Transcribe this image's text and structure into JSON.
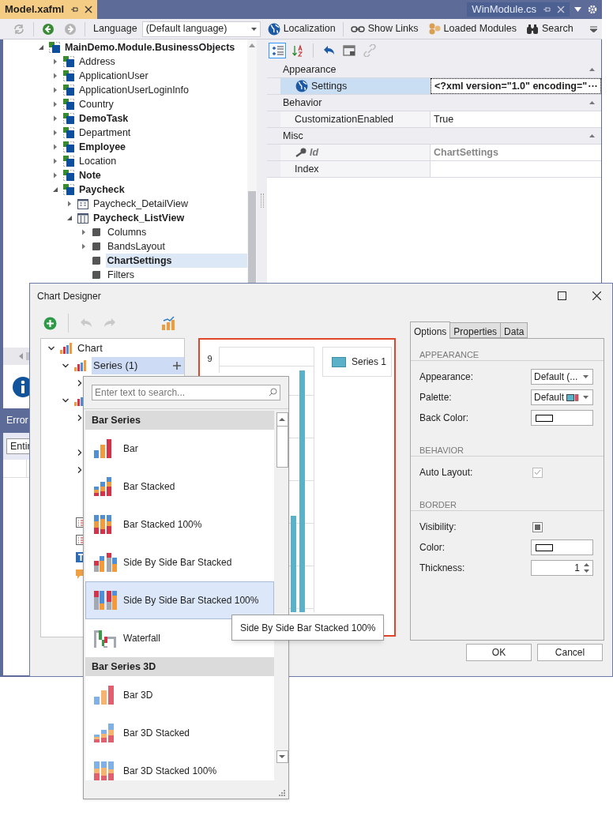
{
  "tabs": [
    {
      "label": "Model.xafml",
      "selected": true
    },
    {
      "label": "WinModule.cs",
      "selected": false
    }
  ],
  "toolbar": {
    "language_label": "Language",
    "language_value": "(Default language)",
    "buttons": [
      {
        "kind": "globe",
        "label": "Localization"
      },
      {
        "kind": "links",
        "label": "Show Links"
      },
      {
        "kind": "modules",
        "label": "Loaded Modules"
      },
      {
        "kind": "search",
        "label": "Search"
      }
    ]
  },
  "model_tree": [
    {
      "label": "MainDemo.Module.BusinessObjects",
      "kind": "class",
      "bold": true,
      "expandable": true,
      "expanded": true,
      "selected": false,
      "children": [
        {
          "label": "Address",
          "kind": "class",
          "bold": false,
          "expandable": true,
          "expanded": false,
          "selected": false
        },
        {
          "label": "ApplicationUser",
          "kind": "class",
          "bold": false,
          "expandable": true,
          "expanded": false,
          "selected": false
        },
        {
          "label": "ApplicationUserLoginInfo",
          "kind": "class",
          "bold": false,
          "expandable": true,
          "expanded": false,
          "selected": false
        },
        {
          "label": "Country",
          "kind": "class",
          "bold": false,
          "expandable": true,
          "expanded": false,
          "selected": false
        },
        {
          "label": "DemoTask",
          "kind": "class",
          "bold": true,
          "expandable": true,
          "expanded": false,
          "selected": false
        },
        {
          "label": "Department",
          "kind": "class",
          "bold": false,
          "expandable": true,
          "expanded": false,
          "selected": false
        },
        {
          "label": "Employee",
          "kind": "class",
          "bold": true,
          "expandable": true,
          "expanded": false,
          "selected": false
        },
        {
          "label": "Location",
          "kind": "class",
          "bold": false,
          "expandable": true,
          "expanded": false,
          "selected": false
        },
        {
          "label": "Note",
          "kind": "class",
          "bold": true,
          "expandable": true,
          "expanded": false,
          "selected": false
        },
        {
          "label": "Paycheck",
          "kind": "class",
          "bold": true,
          "expandable": true,
          "expanded": true,
          "selected": false,
          "children": [
            {
              "label": "Paycheck_DetailView",
              "kind": "detail_view",
              "bold": false,
              "expandable": true,
              "expanded": false,
              "selected": false
            },
            {
              "label": "Paycheck_ListView",
              "kind": "list_view",
              "bold": true,
              "expandable": true,
              "expanded": true,
              "selected": false,
              "children": [
                {
                  "label": "Columns",
                  "kind": "node",
                  "bold": false,
                  "expandable": true,
                  "expanded": false,
                  "selected": false
                },
                {
                  "label": "BandsLayout",
                  "kind": "node",
                  "bold": false,
                  "expandable": true,
                  "expanded": false,
                  "selected": false
                },
                {
                  "label": "ChartSettings",
                  "kind": "node",
                  "bold": true,
                  "expandable": false,
                  "selected": true
                },
                {
                  "label": "Filters",
                  "kind": "node",
                  "bold": false,
                  "expandable": false,
                  "selected": false
                }
              ]
            }
          ]
        }
      ]
    }
  ],
  "property_grid": {
    "toolbar": [
      {
        "kind": "categorized",
        "selected": true,
        "disabled": false
      },
      {
        "kind": "alphabetical",
        "selected": false,
        "disabled": false
      },
      {
        "kind": "undo",
        "selected": false,
        "disabled": false
      },
      {
        "kind": "window",
        "selected": false,
        "disabled": false
      },
      {
        "kind": "link",
        "selected": false,
        "disabled": true
      }
    ],
    "categories": [
      {
        "name": "Appearance",
        "expanded": true,
        "rows": [
          {
            "name": "Settings",
            "kind": "globe",
            "value": "<?xml version=\"1.0\" encoding=\"",
            "button": "···",
            "selected": true,
            "readonly": false
          }
        ]
      },
      {
        "name": "Behavior",
        "expanded": true,
        "rows": [
          {
            "name": "CustomizationEnabled",
            "kind": "plain",
            "value": "True",
            "selected": false,
            "readonly": false
          }
        ]
      },
      {
        "name": "Misc",
        "expanded": true,
        "rows": [
          {
            "name": "Id",
            "kind": "key",
            "value": "ChartSettings",
            "selected": false,
            "readonly": true
          },
          {
            "name": "Index",
            "kind": "plain",
            "selected": false,
            "readonly": false
          }
        ]
      }
    ]
  },
  "bottom_panel": {
    "title": "Error",
    "filter_value": "Entir"
  },
  "dialog": {
    "title": "Chart Designer",
    "tree": [
      {
        "label": "Chart",
        "kind": "chart",
        "expanded": true,
        "selected": false,
        "children": [
          {
            "label": "Series (1)",
            "kind": "series",
            "expanded": true,
            "selected": true
          }
        ]
      }
    ],
    "chart_preview": {
      "y_tick": "9",
      "legend": [
        {
          "label": "Series 1",
          "color": "#5ab1c8"
        }
      ]
    },
    "tabs": [
      {
        "label": "Options",
        "selected": true
      },
      {
        "label": "Properties",
        "selected": false
      },
      {
        "label": "Data",
        "selected": false
      }
    ],
    "sections": [
      {
        "title": "APPEARANCE",
        "rows": [
          {
            "kind": "combo",
            "label": "Appearance:",
            "value": "Default (..."
          },
          {
            "kind": "palette",
            "label": "Palette:",
            "value": "Default"
          },
          {
            "kind": "color",
            "label": "Back Color:"
          }
        ]
      },
      {
        "title": "BEHAVIOR",
        "rows": [
          {
            "kind": "checkbox",
            "label": "Auto Layout:",
            "checked": true,
            "disabled": true
          }
        ]
      },
      {
        "title": "BORDER",
        "rows": [
          {
            "kind": "checkbox",
            "label": "Visibility:",
            "indeterminate": true,
            "disabled": false
          },
          {
            "kind": "color",
            "label": "Color:"
          },
          {
            "kind": "spin",
            "label": "Thickness:",
            "value": "1"
          }
        ]
      }
    ],
    "buttons": [
      "OK",
      "Cancel"
    ]
  },
  "series_popup": {
    "placeholder": "Enter text to search...",
    "groups": [
      {
        "title": "Bar Series",
        "items": [
          {
            "label": "Bar",
            "kind": "bar",
            "selected": false
          },
          {
            "label": "Bar Stacked",
            "kind": "bar_stacked",
            "selected": false
          },
          {
            "label": "Bar Stacked 100%",
            "kind": "bar_stacked_100",
            "selected": false
          },
          {
            "label": "Side By Side Bar Stacked",
            "kind": "side_stacked",
            "selected": false
          },
          {
            "label": "Side By Side Bar Stacked 100%",
            "kind": "side_stacked_100",
            "selected": true
          },
          {
            "label": "Waterfall",
            "kind": "waterfall",
            "selected": false
          }
        ]
      },
      {
        "title": "Bar Series 3D",
        "items": [
          {
            "label": "Bar 3D",
            "kind": "bar_3d",
            "selected": false
          },
          {
            "label": "Bar 3D Stacked",
            "kind": "bar_3d_stacked",
            "selected": false
          },
          {
            "label": "Bar 3D Stacked 100%",
            "kind": "bar_3d_stacked_100",
            "selected": false
          }
        ]
      }
    ]
  },
  "tooltip": "Side By Side Bar Stacked 100%"
}
